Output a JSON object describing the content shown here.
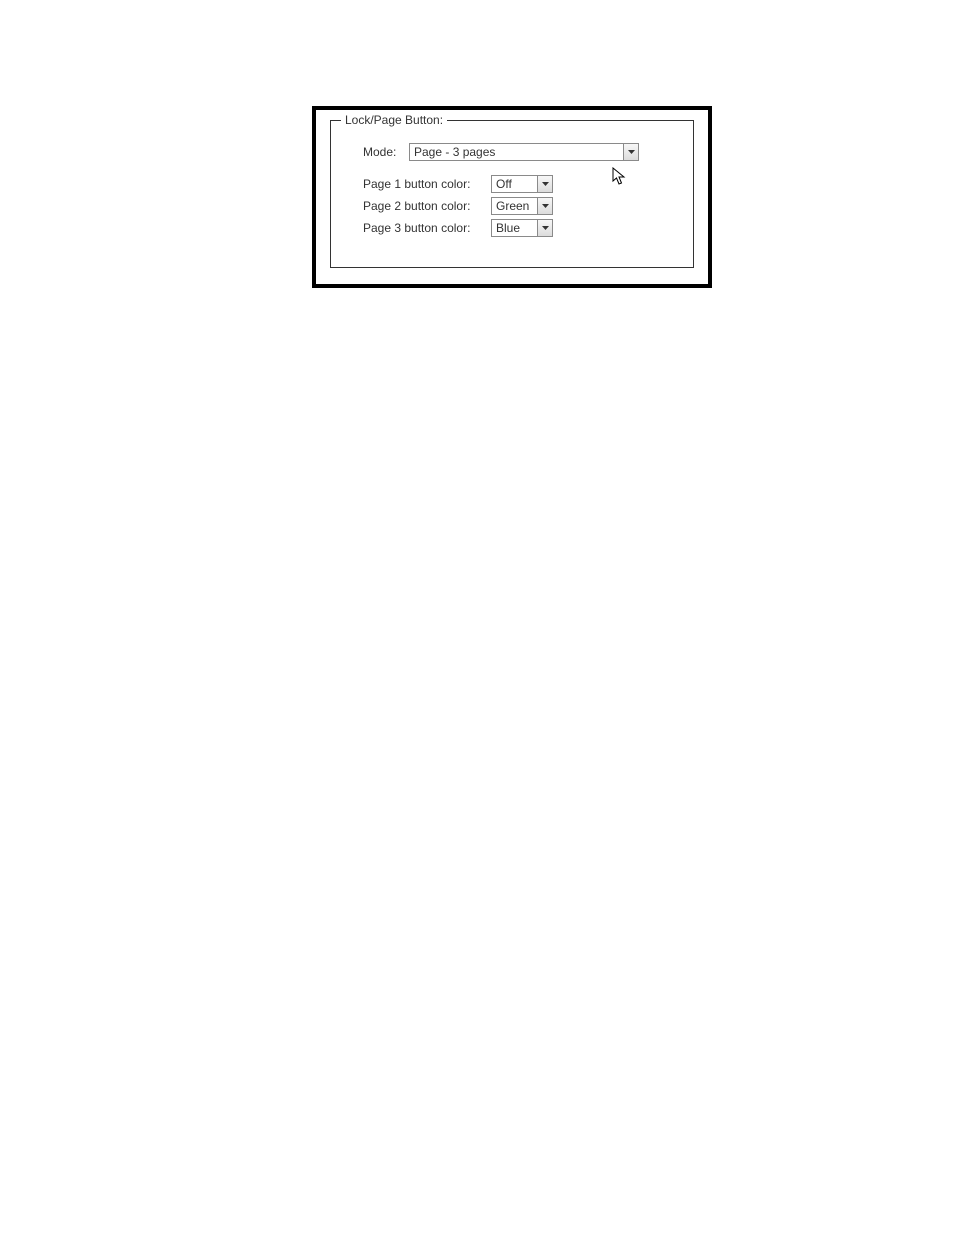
{
  "panel": {
    "legend": "Lock/Page Button:"
  },
  "mode": {
    "label": "Mode:",
    "value": "Page - 3 pages"
  },
  "colors": [
    {
      "label": "Page 1 button color:",
      "value": "Off"
    },
    {
      "label": "Page 2 button color:",
      "value": "Green"
    },
    {
      "label": "Page 3 button color:",
      "value": "Blue"
    }
  ]
}
